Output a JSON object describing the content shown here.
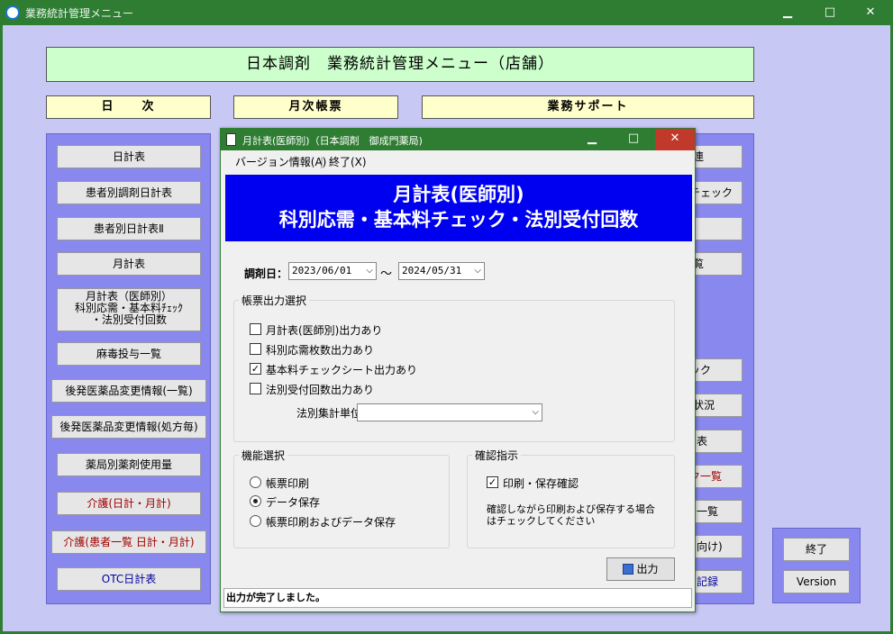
{
  "main_window": {
    "title": "業務統計管理メニュー",
    "minimize": "▁",
    "maximize": "□",
    "close": "✕"
  },
  "header": {
    "title": "日本調剤　業務統計管理メニュー（店舗）"
  },
  "sections": {
    "daily": "日　　次",
    "monthly": "月次帳票",
    "support": "業務サポート"
  },
  "left_buttons": [
    "日計表",
    "患者別調剤日計表",
    "患者別日計表Ⅱ",
    "月計表",
    "月計表（医師別）",
    "科別応需・基本料ﾁｪｯｸ",
    "・法別受付回数",
    "麻毒投与一覧",
    "後発医薬品変更情報(一覧)",
    "後発医薬品変更情報(処方毎)",
    "薬局別薬剤使用量",
    "介護(日計・月計)",
    "介護(患者一覧 日計・月計)",
    "OTC日計表"
  ],
  "right_buttons_visible": [
    "連",
    "チェック",
    "",
    "覧",
    "ック",
    "状況",
    "表",
    "ク一覧",
    "一覧",
    "向け)",
    "記録"
  ],
  "far_right": {
    "exit": "終了",
    "version": "Version"
  },
  "dialog": {
    "title": "月計表(医師別)（日本調剤　御成門薬局)",
    "menu": {
      "version_info": "バージョン情報(A)",
      "exit": "終了(X)"
    },
    "banner_line1": "月計表(医師別)",
    "banner_line2": "科別応需・基本料チェック・法別受付回数",
    "date_label": "調剤日：",
    "date_from": "2023/06/01",
    "date_sep": "〜",
    "date_to": "2024/05/31",
    "report_group": "帳票出力選択",
    "checks": [
      {
        "label": "月計表(医師別)出力あり",
        "checked": false
      },
      {
        "label": "科別応需枚数出力あり",
        "checked": false
      },
      {
        "label": "基本料チェックシート出力あり",
        "checked": true
      },
      {
        "label": "法別受付回数出力あり",
        "checked": false
      }
    ],
    "hobetsu_label": "法別集計単位",
    "hobetsu_value": "",
    "func_group": "機能選択",
    "radios": [
      {
        "label": "帳票印刷",
        "selected": false
      },
      {
        "label": "データ保存",
        "selected": true
      },
      {
        "label": "帳票印刷およびデータ保存",
        "selected": false
      }
    ],
    "confirm_group": "確認指示",
    "confirm_check": {
      "label": "印刷・保存確認",
      "checked": true
    },
    "confirm_note1": "確認しながら印刷および保存する場合",
    "confirm_note2": "はチェックしてください",
    "output_button": "出力",
    "status": "出力が完了しました。"
  }
}
